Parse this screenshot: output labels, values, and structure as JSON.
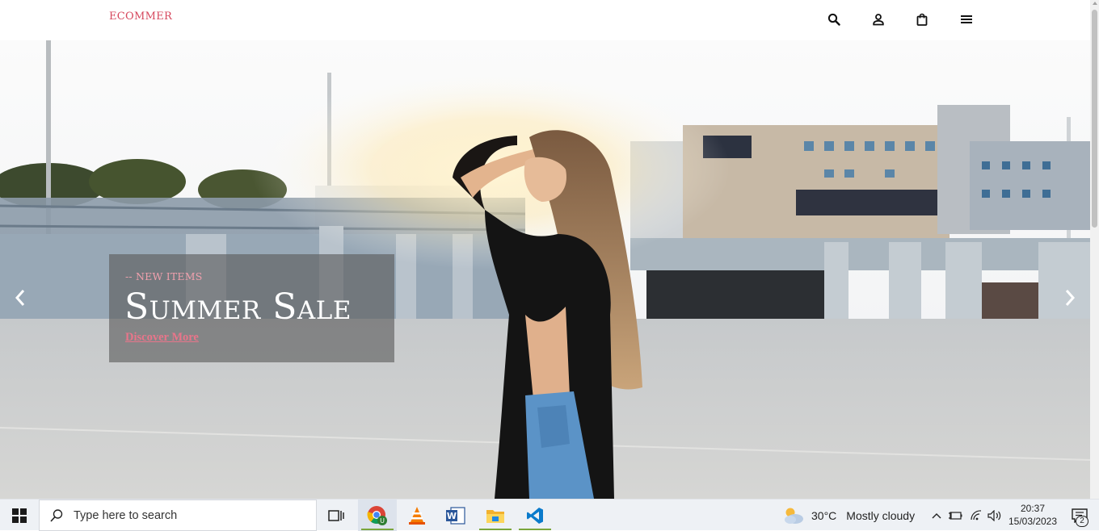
{
  "header": {
    "brand": "ECOMMER",
    "icons": [
      "search-icon",
      "account-icon",
      "shopping-bag-icon",
      "menu-icon"
    ]
  },
  "hero": {
    "kicker": "-- NEW ITEMS",
    "title": "Summer Sale",
    "cta_label": "Discover More",
    "arrows": [
      "chevron-left-icon",
      "chevron-right-icon"
    ]
  },
  "taskbar": {
    "search_placeholder": "Type here to search",
    "apps": [
      "task-view-icon",
      "chrome-icon",
      "vlc-icon",
      "word-icon",
      "file-explorer-icon",
      "vscode-icon"
    ],
    "weather": {
      "temp": "30°C",
      "condition": "Mostly cloudy"
    },
    "clock": {
      "time": "20:37",
      "date": "15/03/2023"
    },
    "notifications_count": "2"
  },
  "colors": {
    "brand": "#d6475d",
    "kicker": "#f0a0ad",
    "cta": "#e8758a",
    "promo_overlay": "rgba(90,90,90,0.62)"
  }
}
